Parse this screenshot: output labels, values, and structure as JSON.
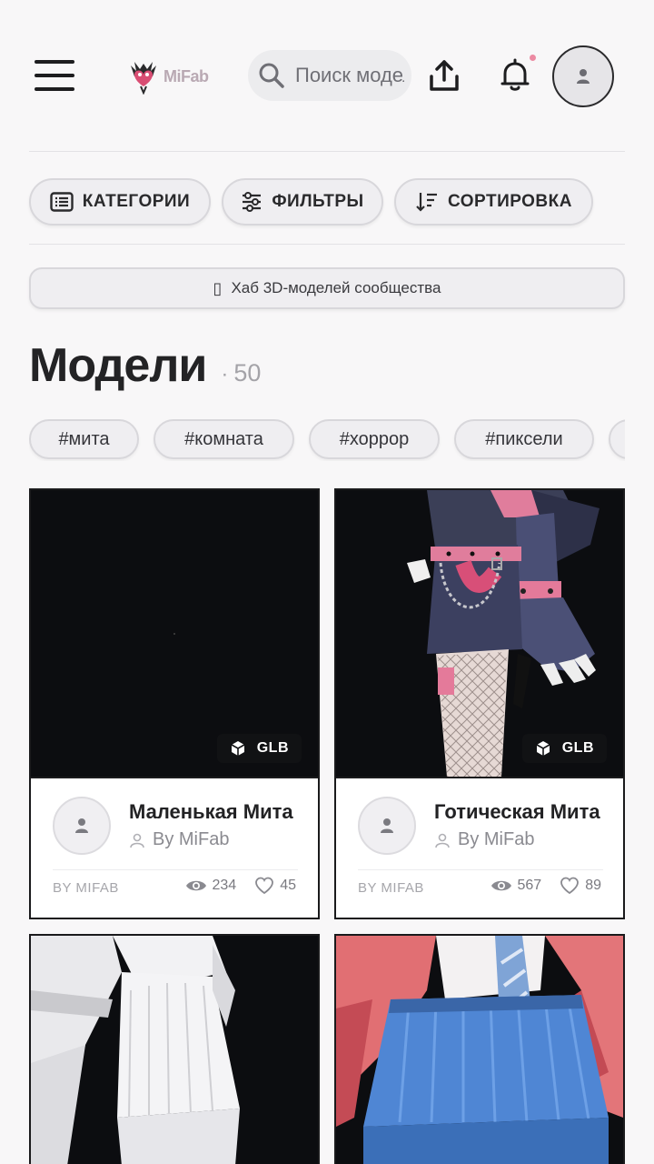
{
  "header": {
    "logo_text": "MiFab",
    "search_placeholder": "Поиск моделей",
    "notification_dot_color": "#ec8aa2"
  },
  "toolbar": {
    "categories_label": "КАТЕГОРИИ",
    "filters_label": "ФИЛЬТРЫ",
    "sort_label": "СОРТИРОВКА"
  },
  "banner": {
    "icon_glyph": "▯",
    "text": "Хаб 3D-моделей сообщества"
  },
  "page": {
    "title": "Модели",
    "count_sep": "·",
    "count": "50"
  },
  "tags": [
    "#мита",
    "#комната",
    "#хоррор",
    "#пиксели",
    "#"
  ],
  "cards": [
    {
      "title": "Маленькая Мита",
      "author": "By MiFab",
      "format": "GLB",
      "footer_by": "BY MIFAB",
      "views": "234",
      "likes": "45"
    },
    {
      "title": "Готическая Мита",
      "author": "By MiFab",
      "format": "GLB",
      "footer_by": "BY MIFAB",
      "views": "567",
      "likes": "89"
    }
  ],
  "icons": {
    "menu": "hamburger-menu-icon",
    "search": "search-icon",
    "upload": "upload-icon",
    "bell": "bell-icon",
    "avatar": "user-icon",
    "categories": "list-icon",
    "filters": "sliders-icon",
    "sort": "sort-icon",
    "format": "cube-icon",
    "views": "eye-icon",
    "likes": "heart-icon"
  },
  "colors": {
    "background": "#f8f7f8",
    "thumbnail_bg": "#0c0d10",
    "accent_pink": "#ec8aa2"
  }
}
